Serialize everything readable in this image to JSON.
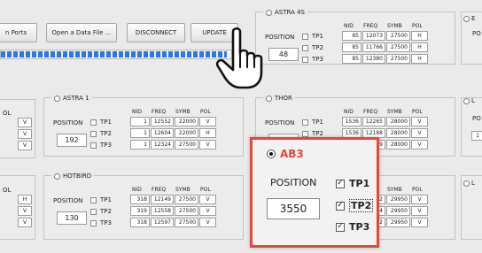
{
  "toolbar": {
    "ports_label": "n Ports",
    "open_label": "Open a Data File ...",
    "disconnect_label": "DISCONNECT",
    "update_label": "UPDATE"
  },
  "progress": {
    "fraction": 0.98
  },
  "table_headers": {
    "nid": "NID",
    "freq": "FREQ",
    "symb": "SYMB",
    "pol": "POL"
  },
  "position_label": "POSITION",
  "panels": [
    {
      "title": "ASTRA 4S",
      "radio_on": false,
      "position": "48",
      "rows": [
        {
          "tp": "TP1",
          "nid": "85",
          "freq": "12073",
          "symb": "27500",
          "pol": "H"
        },
        {
          "tp": "TP2",
          "nid": "85",
          "freq": "11766",
          "symb": "27500",
          "pol": "H"
        },
        {
          "tp": "TP3",
          "nid": "85",
          "freq": "12380",
          "symb": "27500",
          "pol": "H"
        }
      ]
    },
    {
      "title": "ASTRA 1",
      "radio_on": false,
      "position": "192",
      "rows": [
        {
          "tp": "TP1",
          "nid": "1",
          "freq": "12552",
          "symb": "22000",
          "pol": "V"
        },
        {
          "tp": "TP2",
          "nid": "1",
          "freq": "12604",
          "symb": "22000",
          "pol": "H"
        },
        {
          "tp": "TP3",
          "nid": "1",
          "freq": "12324",
          "symb": "27500",
          "pol": "V"
        }
      ]
    },
    {
      "title": "THOR",
      "radio_on": false,
      "position": "",
      "rows": [
        {
          "tp": "TP1",
          "nid": "1536",
          "freq": "12265",
          "symb": "28000",
          "pol": "V"
        },
        {
          "tp": "TP2",
          "nid": "1536",
          "freq": "12188",
          "symb": "28000",
          "pol": "V"
        },
        {
          "tp": "TP3",
          "nid": "",
          "freq": "919",
          "symb": "28000",
          "pol": "V"
        }
      ]
    },
    {
      "title": "HOTBIRD",
      "radio_on": false,
      "position": "130",
      "rows": [
        {
          "tp": "TP1",
          "nid": "318",
          "freq": "12149",
          "symb": "27500",
          "pol": "V"
        },
        {
          "tp": "TP2",
          "nid": "319",
          "freq": "12558",
          "symb": "27500",
          "pol": "V"
        },
        {
          "tp": "TP3",
          "nid": "318",
          "freq": "12597",
          "symb": "27500",
          "pol": "V"
        }
      ]
    },
    {
      "title": "",
      "radio_on": false,
      "position": "",
      "rows": [
        {
          "tp": "",
          "nid": "",
          "freq": "512",
          "symb": "29950",
          "pol": "V"
        },
        {
          "tp": "",
          "nid": "",
          "freq": "454",
          "symb": "29950",
          "pol": "V"
        },
        {
          "tp": "",
          "nid": "",
          "freq": "972",
          "symb": "29950",
          "pol": "V"
        }
      ]
    }
  ],
  "left_edge": {
    "pol_label_1": "OL",
    "pol_label_2": "OL",
    "values_1": [
      "V",
      "V",
      "V"
    ],
    "values_2": [
      "H",
      "V",
      "V"
    ]
  },
  "right_edge": {
    "letter_1": "E",
    "letter_2": "L",
    "letter_3": "L",
    "label": "PO",
    "value": "1"
  },
  "callout": {
    "title": "AB3",
    "position_label": "POSITION",
    "position_value": "3550",
    "tp1": "TP1",
    "tp2": "TP2",
    "tp3": "TP3"
  },
  "colors": {
    "accent_red": "#e04a3c",
    "progress_blue": "#2a79e6"
  },
  "icons": {
    "cursor": "hand-pointer-icon"
  }
}
